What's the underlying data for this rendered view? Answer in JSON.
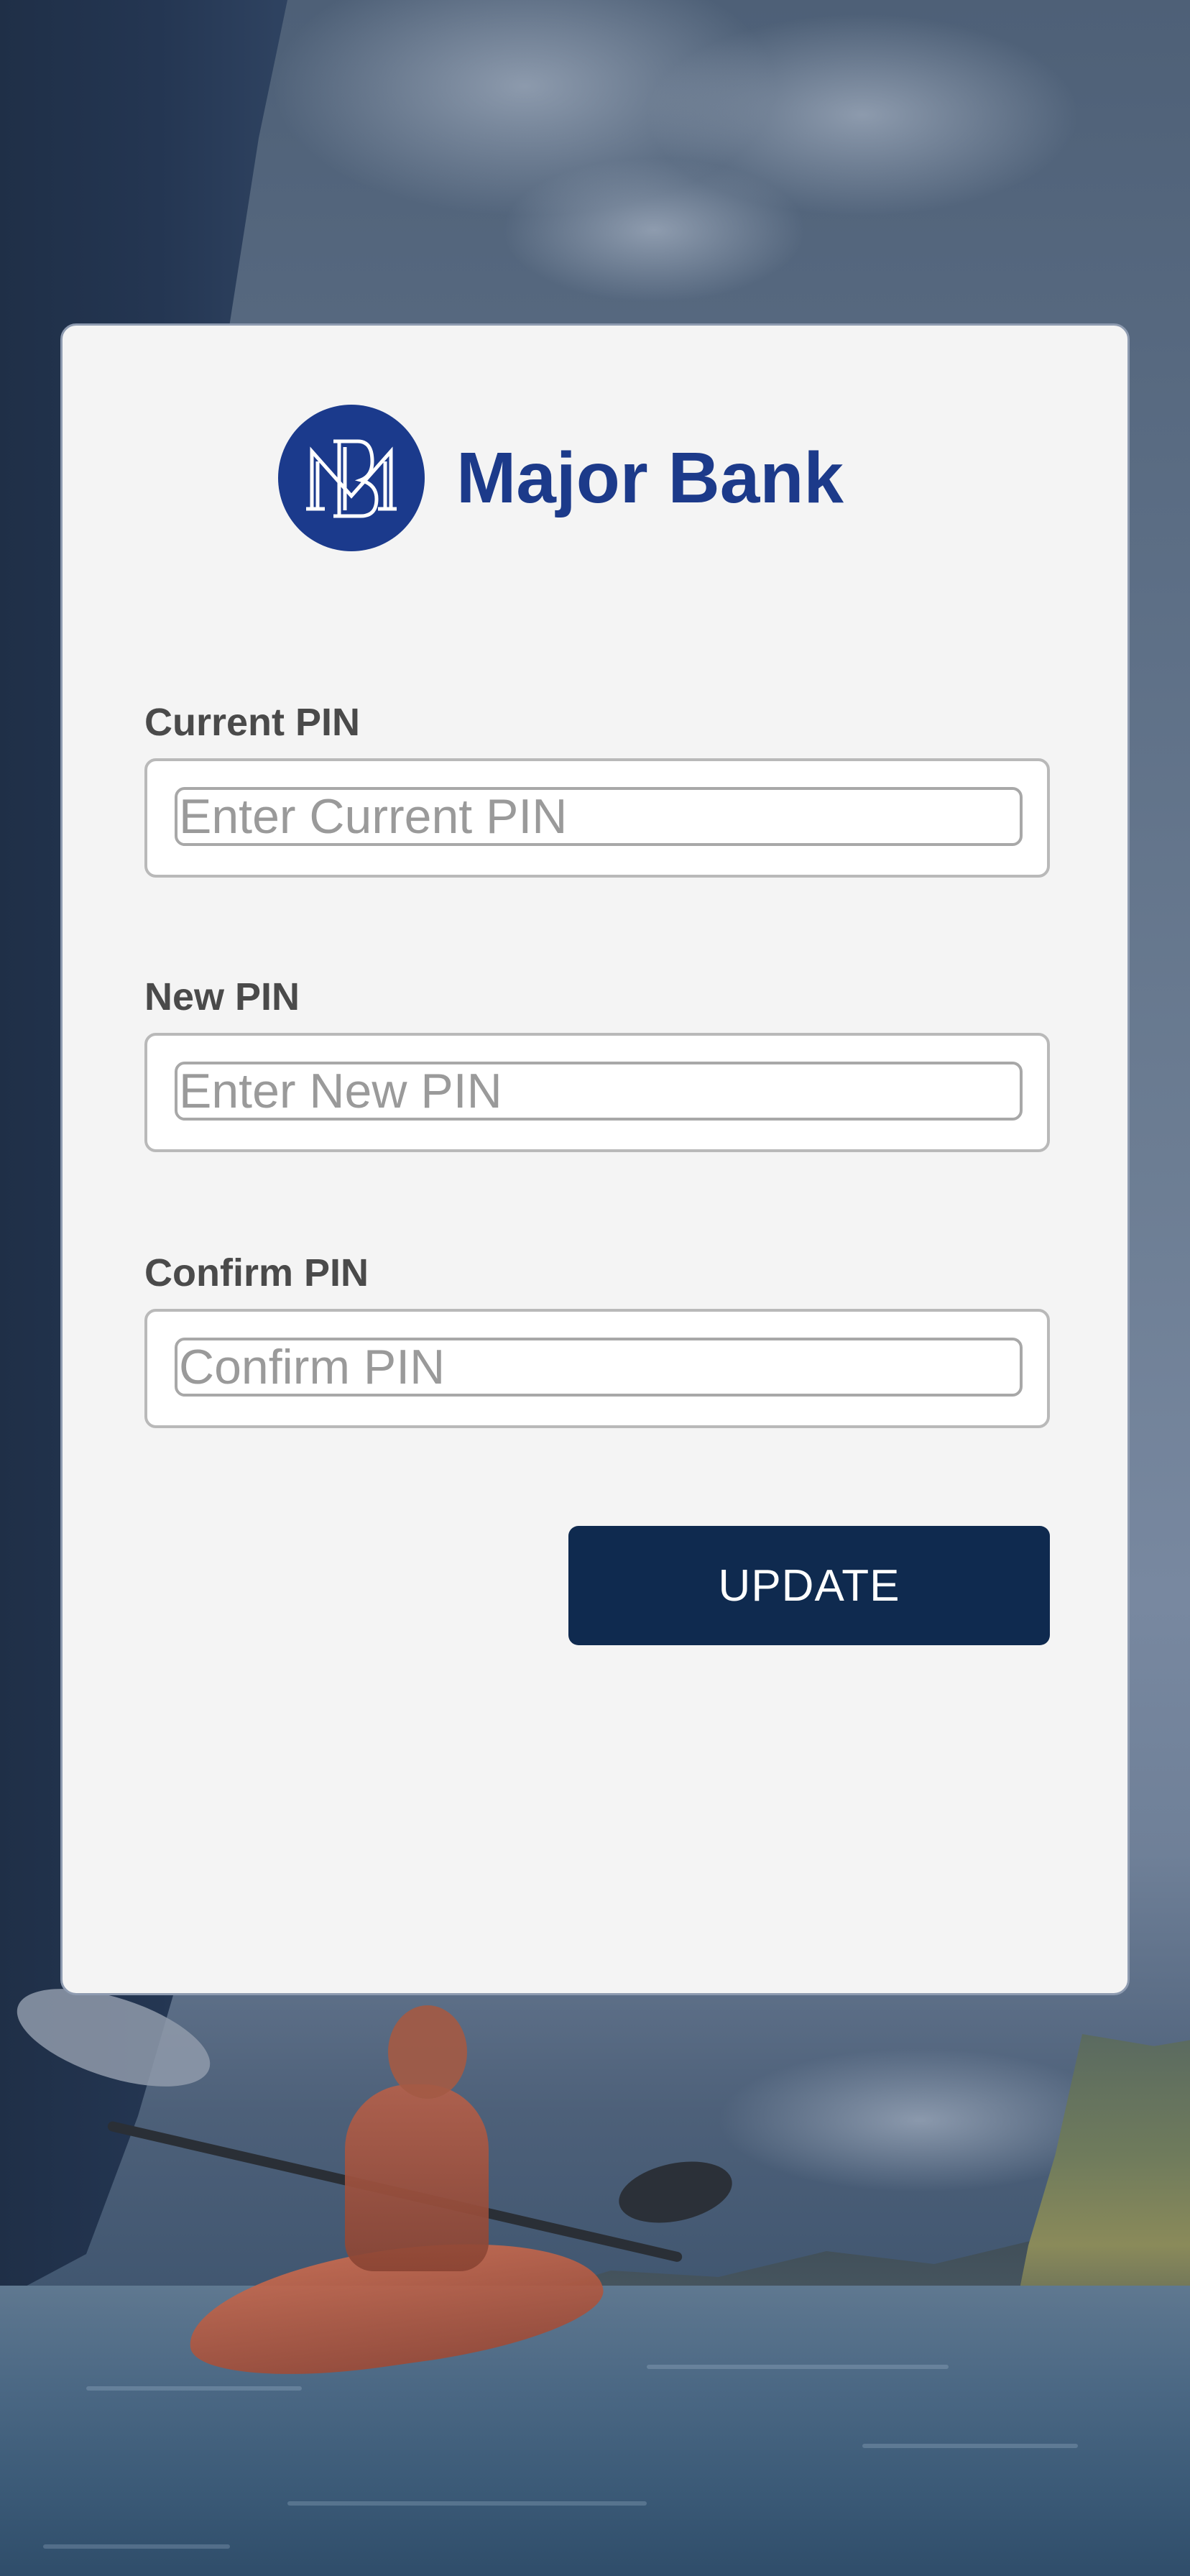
{
  "brand": {
    "name": "Major Bank",
    "logo_icon": "bank-monogram-icon",
    "logo_color": "#1b3a8c",
    "name_color": "#1c3a8a"
  },
  "form": {
    "current_pin": {
      "label": "Current PIN",
      "placeholder": "Enter Current PIN",
      "value": ""
    },
    "new_pin": {
      "label": "New PIN",
      "placeholder": "Enter New PIN",
      "value": ""
    },
    "confirm_pin": {
      "label": "Confirm PIN",
      "placeholder": "Confirm PIN",
      "value": ""
    },
    "submit": {
      "label": "UPDATE",
      "color": "#0f2a4f"
    }
  },
  "card": {
    "background_color": "#f4f4f4",
    "border_color": "#8e9bb0"
  }
}
